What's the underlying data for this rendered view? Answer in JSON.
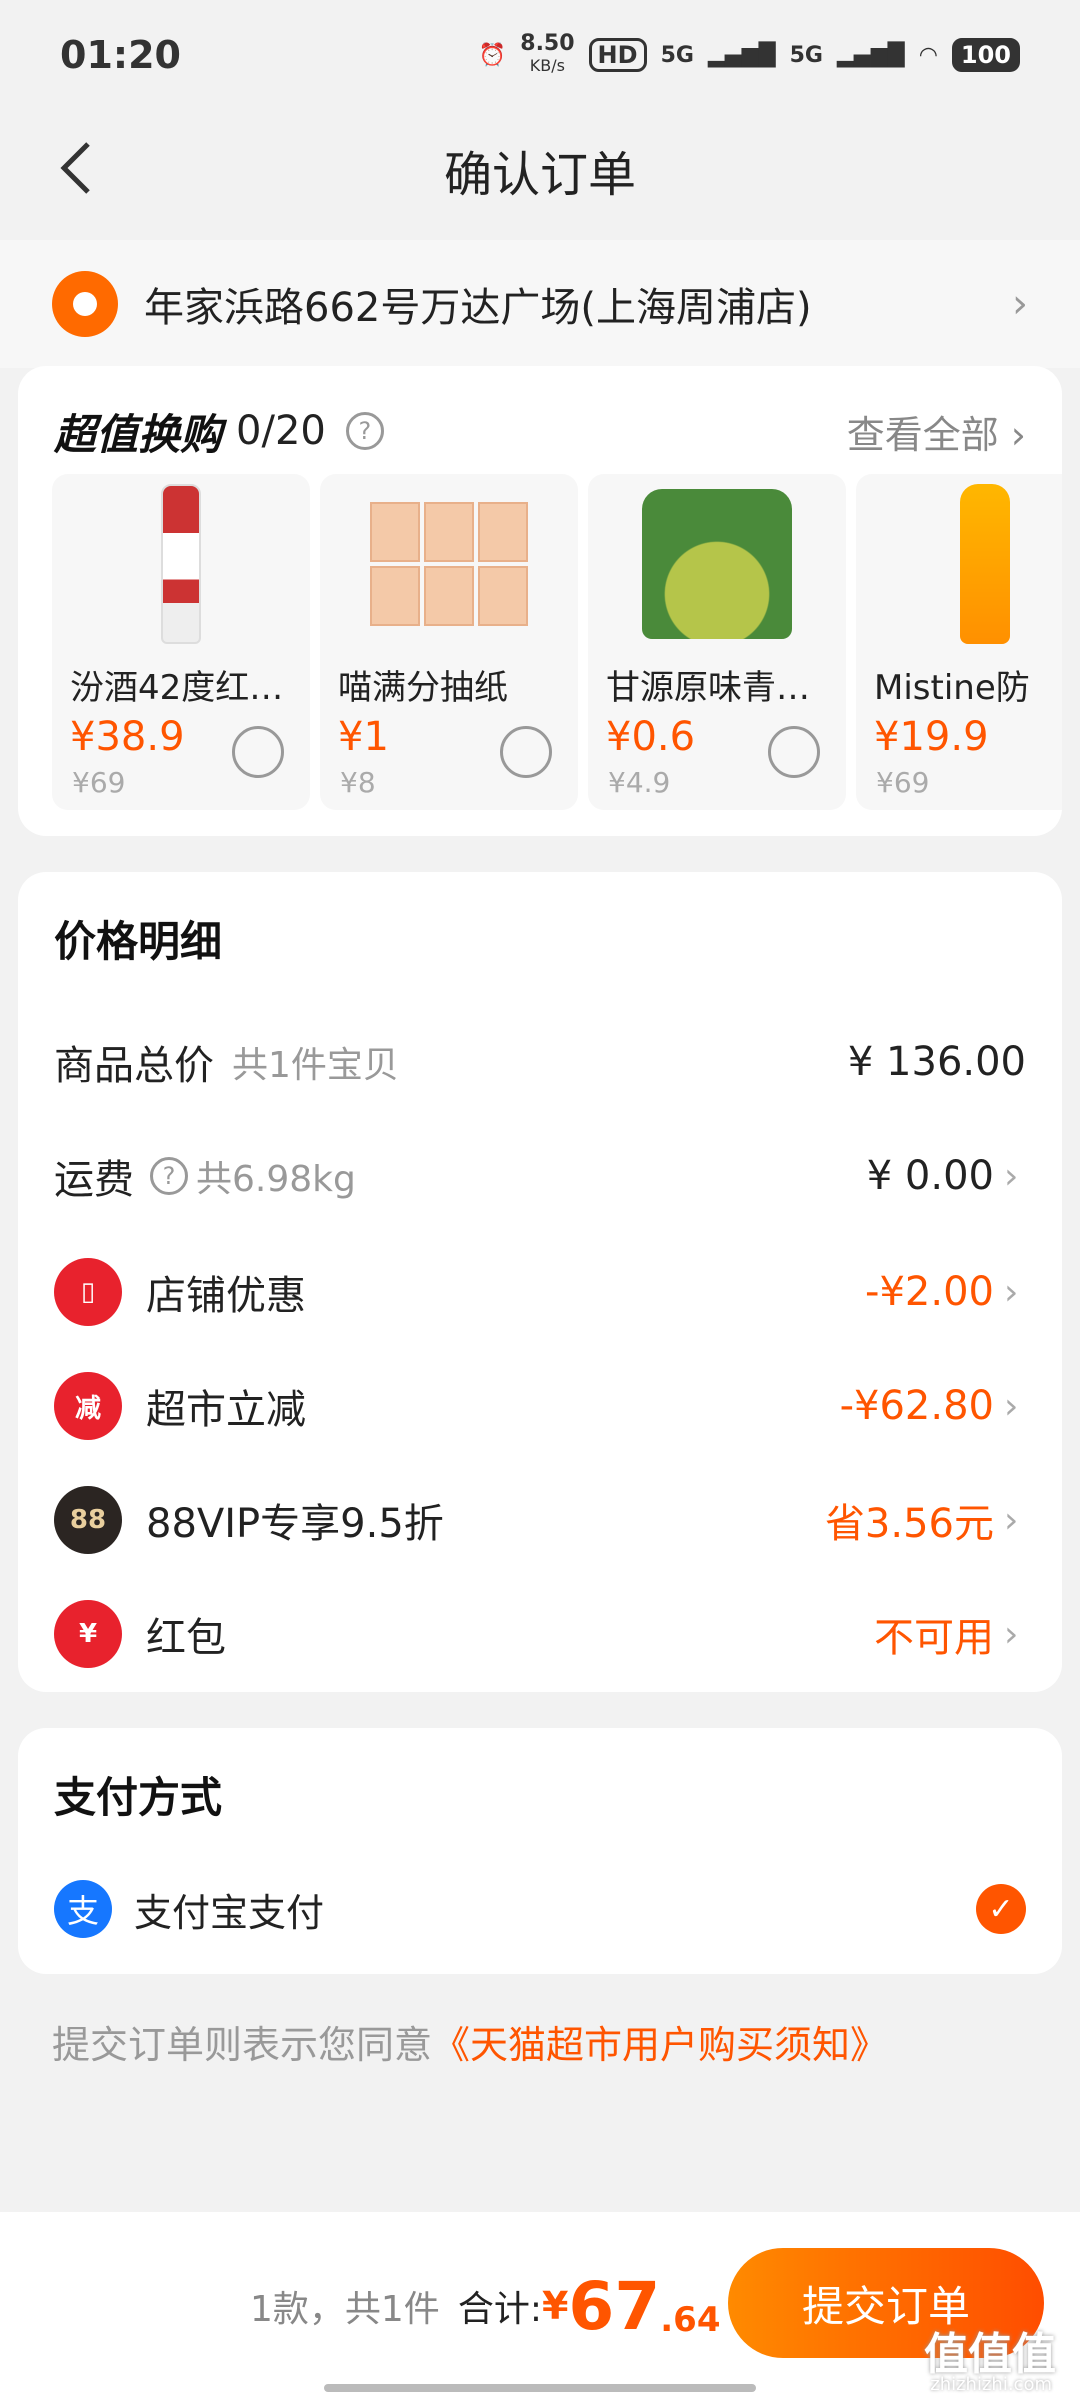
{
  "status_bar": {
    "time": "01:20",
    "speed": "8.50",
    "speed_unit": "KB/s",
    "hd": "HD",
    "net1": "5G",
    "net2": "5G",
    "battery": "100"
  },
  "header": {
    "title": "确认订单"
  },
  "address": {
    "text": "年家浜路662号万达广场(上海周浦店)"
  },
  "exchange": {
    "title": "超值换购",
    "count": "0/20",
    "view_all": "查看全部",
    "products": [
      {
        "name": "汾酒42度红…",
        "price": "¥38.9",
        "original": "¥69",
        "selected": false
      },
      {
        "name": "喵满分抽纸",
        "price": "¥1",
        "original": "¥8",
        "selected": false
      },
      {
        "name": "甘源原味青…",
        "price": "¥0.6",
        "original": "¥4.9",
        "selected": false
      },
      {
        "name": "Mistine防",
        "price": "¥19.9",
        "original": "¥69",
        "selected": false
      }
    ]
  },
  "price_detail": {
    "title": "价格明细",
    "goods_total_label": "商品总价",
    "goods_total_sub": "共1件宝贝",
    "goods_total_value": "¥ 136.00",
    "shipping_label": "运费",
    "shipping_sub": "共6.98kg",
    "shipping_value": "¥ 0.00",
    "store_discount_label": "店铺优惠",
    "store_discount_value": "-¥2.00",
    "market_discount_label": "超市立减",
    "market_discount_icon_text": "减",
    "market_discount_value": "-¥62.80",
    "vip_label": "88VIP专享9.5折",
    "vip_icon_text": "88",
    "vip_value": "省3.56元",
    "redpacket_label": "红包",
    "redpacket_icon_text": "¥",
    "redpacket_value": "不可用"
  },
  "payment": {
    "title": "支付方式",
    "method_icon_text": "支",
    "method": "支付宝支付"
  },
  "agreement": {
    "prefix": "提交订单则表示您同意",
    "link": "《天猫超市用户购买须知》"
  },
  "bottom": {
    "count": "1款，共1件",
    "total_label": "合计:",
    "currency": "¥",
    "total_int": "67",
    "total_dec": ".64",
    "submit": "提交订单"
  },
  "watermark": {
    "text": "值值值",
    "site": "zhizhizhi.com"
  },
  "colors": {
    "accent": "#ff5500",
    "accent_gradient_start": "#ff8a00",
    "alipay_blue": "#1677ff",
    "icon_red": "#e8222d",
    "vip_dark": "#2b2522"
  }
}
